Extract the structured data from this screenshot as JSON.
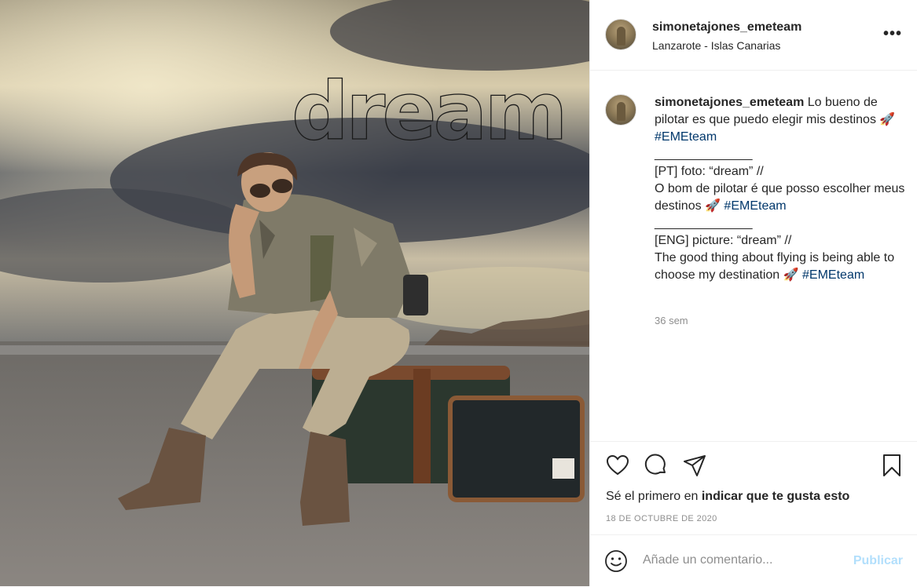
{
  "photo": {
    "overlay_text": "dream",
    "alt": "Woman in aviator sunglasses sitting on a suitcase on a beach under a cloudy sky"
  },
  "post": {
    "username": "simonetajones_emeteam",
    "location": "Lanzarote - Islas Canarias",
    "more_label": "•••"
  },
  "caption": {
    "username": "simonetajones_emeteam",
    "line_es": "Lo bueno de pilotar es que puedo elegir mis destinos 🚀",
    "tag_1": "#EMEteam",
    "separator_1": "______________",
    "pt_title": "[PT] foto: “dream” //",
    "pt_text": "O bom de pilotar é que posso escolher meus destinos 🚀",
    "tag_2": "#EMEteam",
    "separator_2": "______________",
    "en_title": "[ENG] picture: “dream” //",
    "en_text": "The good thing about flying is being able to choose my destination 🚀",
    "tag_3": "#EMEteam",
    "time_ago": "36 sem"
  },
  "likes": {
    "prefix": "Sé el primero en ",
    "action": "indicar que te gusta esto"
  },
  "date": "18 DE OCTUBRE DE 2020",
  "comment_box": {
    "placeholder": "Añade un comentario...",
    "publish_label": "Publicar"
  },
  "colors": {
    "link": "#00376b",
    "publish_disabled": "#b2dffc",
    "meta_gray": "#8e8e8e",
    "divider": "#efefef"
  },
  "icons": [
    "heart-icon",
    "comment-icon",
    "share-icon",
    "bookmark-icon",
    "emoji-icon",
    "more-icon"
  ]
}
